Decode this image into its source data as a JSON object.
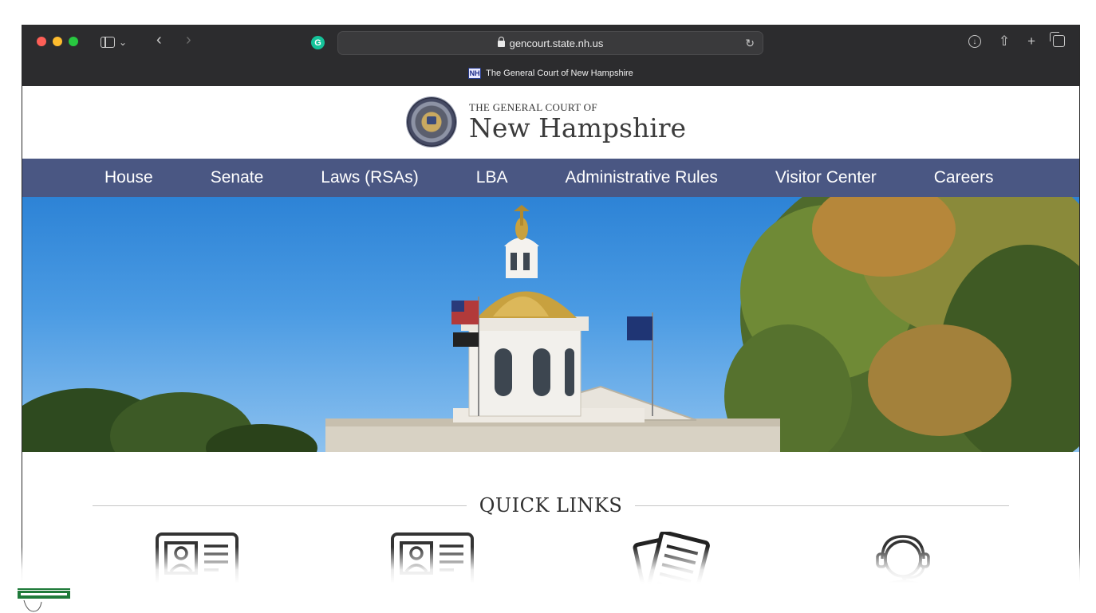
{
  "browser": {
    "url": "gencourt.state.nh.us",
    "tab_title": "The General Court of New Hampshire",
    "favicon_text": "NH",
    "icons": [
      "sidebar-icon",
      "chevron-down-icon",
      "back-icon",
      "forward-icon",
      "grammarly-icon",
      "lock-icon",
      "reload-icon",
      "download-icon",
      "share-icon",
      "new-tab-icon",
      "tab-overview-icon"
    ]
  },
  "header": {
    "small_title": "THE GENERAL COURT OF",
    "big_title": "New Hampshire"
  },
  "nav": {
    "items": [
      "House",
      "Senate",
      "Laws (RSAs)",
      "LBA",
      "Administrative Rules",
      "Visitor Center",
      "Careers"
    ]
  },
  "quick_links": {
    "title": "QUICK LINKS",
    "icons": [
      "contact-card-icon",
      "contact-card-icon",
      "documents-icon",
      "support-agent-icon"
    ]
  },
  "colors": {
    "nav_bg": "#4a5783",
    "chrome_bg": "#2c2c2e",
    "logo_green": "#1f7a3a"
  }
}
